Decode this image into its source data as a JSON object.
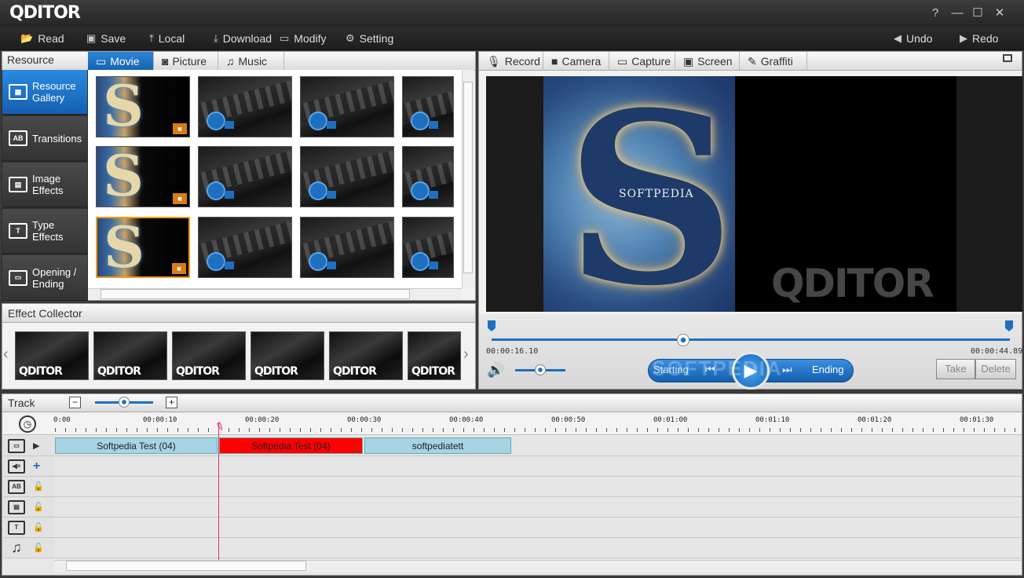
{
  "app": {
    "logo": "QDITOR",
    "window": {
      "help": "?",
      "minimize": "—",
      "maximize": "☐",
      "close": "✕"
    }
  },
  "toolbar": {
    "read": "Read",
    "save": "Save",
    "local": "Local",
    "download": "Download",
    "modify": "Modify",
    "setting": "Setting",
    "undo": "Undo",
    "redo": "Redo"
  },
  "resource": {
    "header": "Resource",
    "tabs": [
      "Movie",
      "Picture",
      "Music"
    ],
    "sidebar": [
      {
        "l1": "Resource",
        "l2": "Gallery"
      },
      {
        "l1": "Transitions",
        "l2": ""
      },
      {
        "l1": "Image",
        "l2": "Effects"
      },
      {
        "l1": "Type",
        "l2": "Effects"
      },
      {
        "l1": "Opening /",
        "l2": "Ending"
      }
    ]
  },
  "effect_collector": {
    "header": "Effect Collector",
    "thumb_label": "QDITOR"
  },
  "capture": {
    "tabs": [
      "Record",
      "Camera",
      "Capture",
      "Screen",
      "Graffiti"
    ]
  },
  "preview": {
    "watermark_text": "SOFTPEDIA",
    "logo_watermark": "QDITOR",
    "time_current": "00:00:16.10",
    "time_total": "00:00:44.89",
    "playhead_fraction": 0.37,
    "volume_fraction": 0.5,
    "starting": "Starting",
    "ending": "Ending",
    "take": "Take",
    "delete": "Delete",
    "softpedia_overlay": "SOFTPEDIA"
  },
  "track": {
    "header": "Track",
    "zoom_fraction": 0.5,
    "ruler": [
      "0:00",
      "00:00:10",
      "00:00:20",
      "00:00:30",
      "00:00:40",
      "00:00:50",
      "00:01:00",
      "00:01:10",
      "00:01:20",
      "00:01:30"
    ],
    "clips": [
      {
        "label": "Softpedia Test (04)",
        "color": "#a6d4e4",
        "text": "#222"
      },
      {
        "label": "Softpedia Test (04)",
        "color": "#ff0000",
        "text": "#222"
      },
      {
        "label": "softpediatett",
        "color": "#a6d4e4",
        "text": "#222"
      }
    ]
  },
  "colors": {
    "accent": "#1d6fc2",
    "selection": "#f39a13",
    "playhead": "#e0306a"
  }
}
